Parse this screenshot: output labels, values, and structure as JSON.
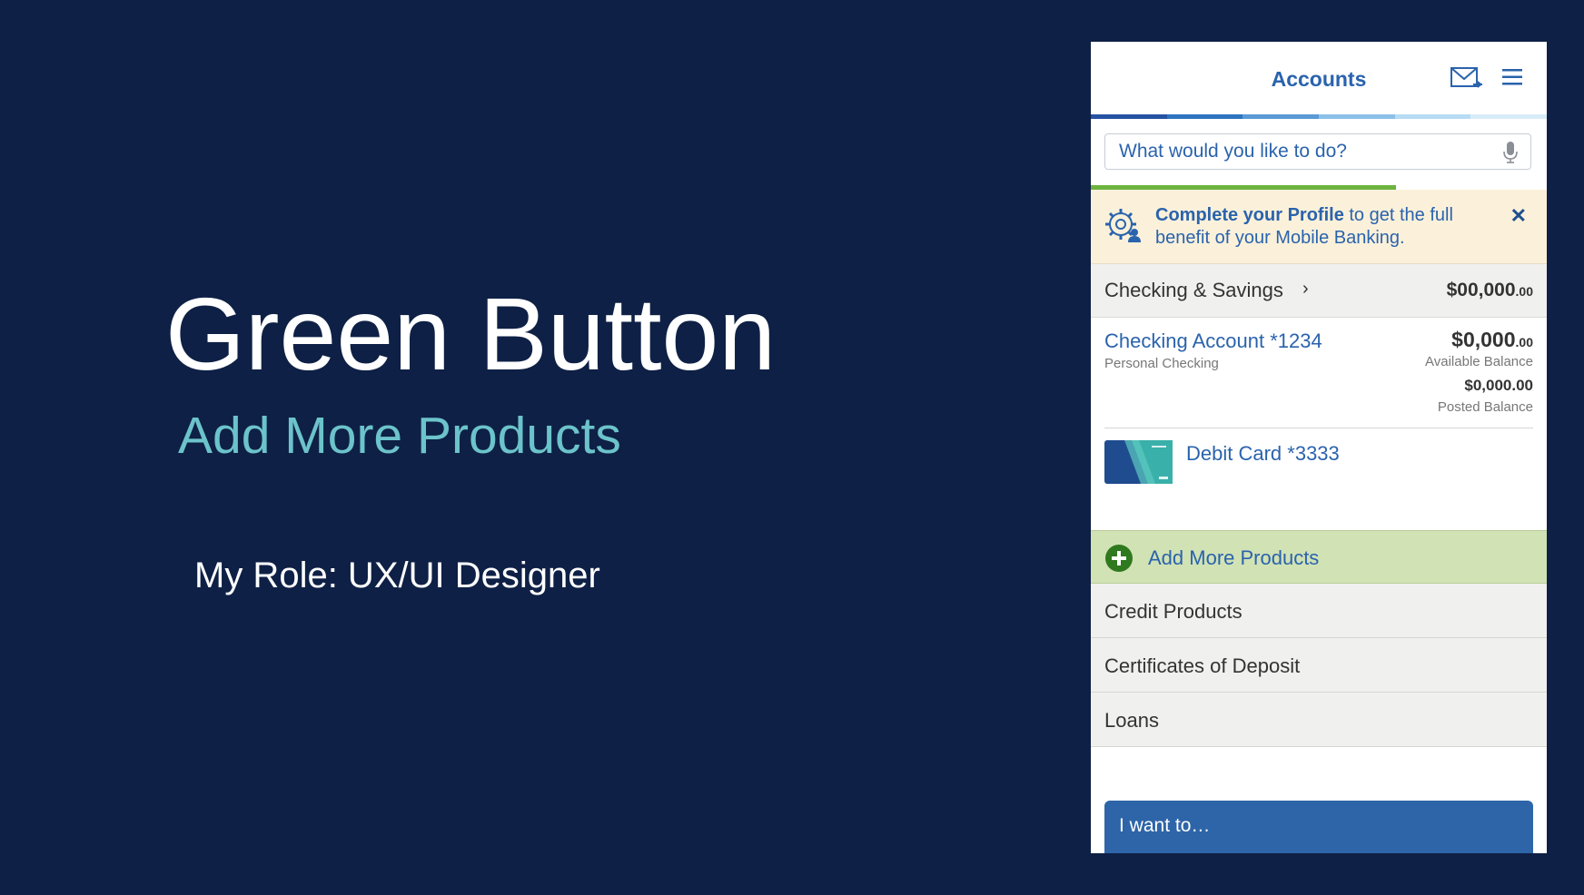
{
  "slide": {
    "title": "Green Button",
    "subtitle": "Add More Products",
    "role": "My Role: UX/UI Designer"
  },
  "colors": {
    "background": "#0e2045",
    "subtitle": "#6cc3cb",
    "brand_blue": "#2a63ad",
    "green_accent": "#6cb33f",
    "add_products_bg": "#d1e2b4",
    "banner_bg": "#fbf1da"
  },
  "app": {
    "header": {
      "title": "Accounts",
      "icons": [
        "mail-icon",
        "menu-icon"
      ]
    },
    "search": {
      "placeholder": "What would you like to do?",
      "icon": "microphone-icon"
    },
    "profile_progress": 0.67,
    "banner": {
      "bold": "Complete your Profile",
      "text": " to get the full benefit of your Mobile Banking.",
      "close": "✕",
      "icon": "gear-person-icon"
    },
    "checking_savings": {
      "label": "Checking & Savings",
      "chevron": "›",
      "amount": "$00,000",
      "cents": ".00"
    },
    "account": {
      "name": "Checking Account *1234",
      "type": "Personal Checking",
      "available_amount": "$0,000",
      "available_cents": ".00",
      "available_label": "Available Balance",
      "posted_amount": "$0,000.00",
      "posted_label": "Posted Balance"
    },
    "debit_card": {
      "name": "Debit Card *3333"
    },
    "add_products": {
      "label": "Add More Products",
      "icon": "plus-circle-icon"
    },
    "products": [
      {
        "label": "Credit Products"
      },
      {
        "label": "Certificates of Deposit"
      },
      {
        "label": "Loans"
      }
    ],
    "i_want_to": "I want to…"
  }
}
